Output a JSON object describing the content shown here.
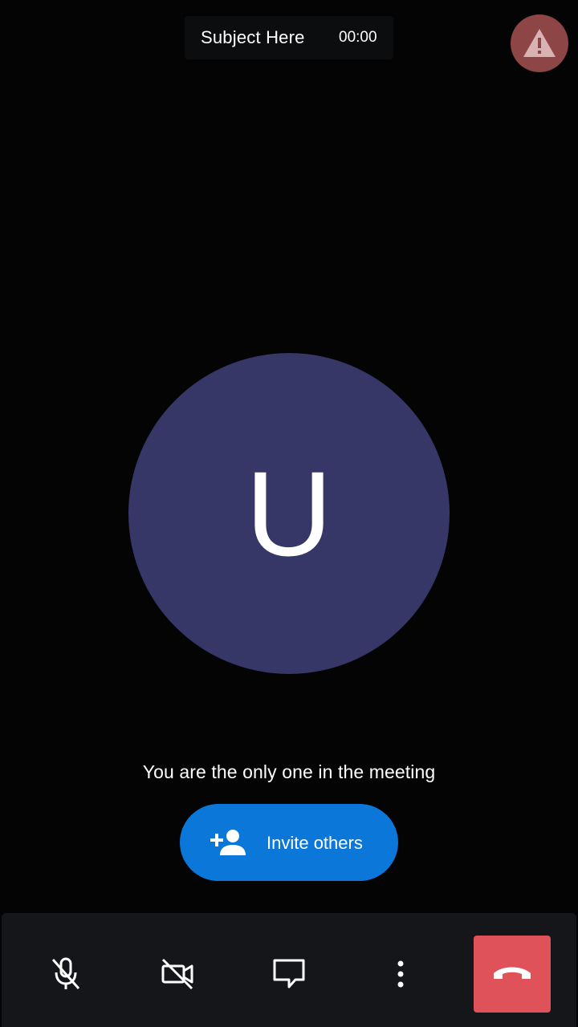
{
  "header": {
    "subject": "Subject Here",
    "timer": "00:00"
  },
  "alert": {
    "icon": "warning-icon",
    "color": "#8e4545"
  },
  "participant": {
    "initial": "U",
    "avatar_color": "#363667"
  },
  "status": {
    "message": "You are the only one in the meeting"
  },
  "invite": {
    "label": "Invite others",
    "icon": "add-person-icon",
    "color": "#0a77d9"
  },
  "toolbar": {
    "buttons": [
      {
        "name": "microphone",
        "icon": "mic-off-icon",
        "state": "muted"
      },
      {
        "name": "camera",
        "icon": "video-off-icon",
        "state": "off"
      },
      {
        "name": "chat",
        "icon": "chat-icon"
      },
      {
        "name": "more",
        "icon": "more-vertical-icon"
      },
      {
        "name": "hangup",
        "icon": "hangup-icon",
        "color": "#e0525a"
      }
    ]
  },
  "colors": {
    "background": "#040405",
    "toolbar_background": "#141619"
  }
}
